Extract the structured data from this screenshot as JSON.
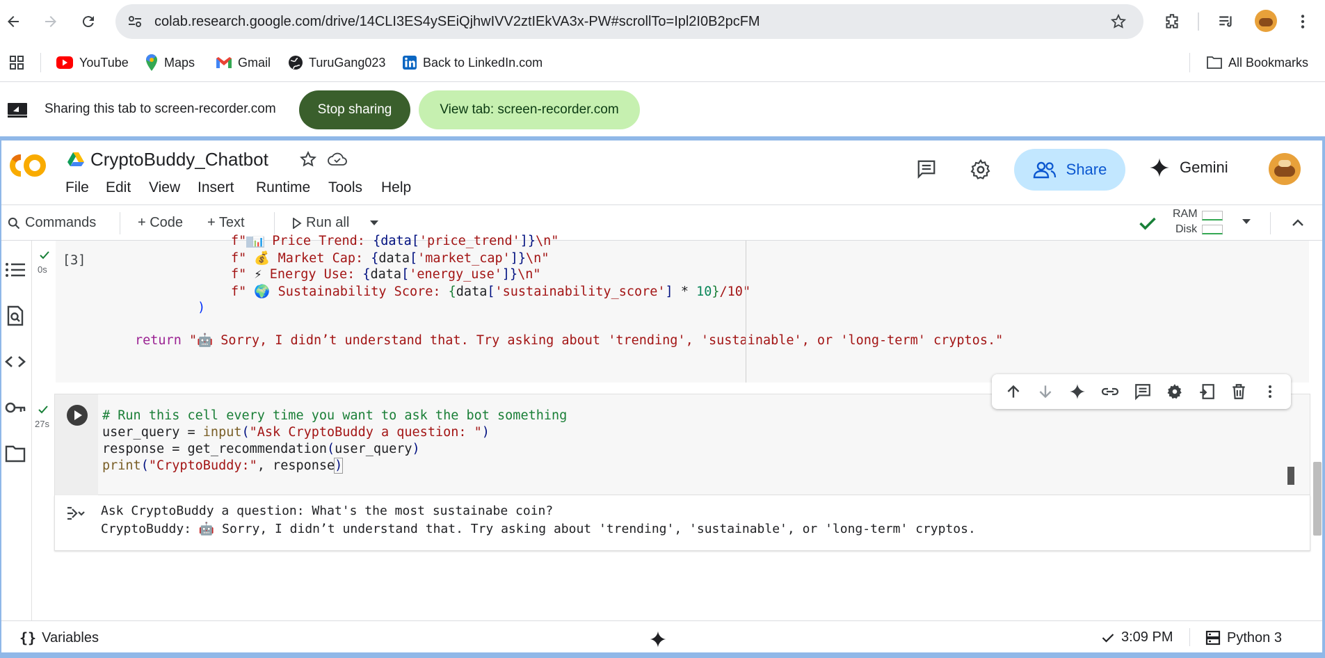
{
  "browser": {
    "url": "colab.research.google.com/drive/14CLI3ES4ySEiQjhwIVV2ztIEkVA3x-PW#scrollTo=Ipl2I0B2pcFM",
    "bookmarks": [
      {
        "label": "YouTube",
        "icon": "youtube-icon"
      },
      {
        "label": "Maps",
        "icon": "maps-icon"
      },
      {
        "label": "Gmail",
        "icon": "gmail-icon"
      },
      {
        "label": "TuruGang023",
        "icon": "globe-icon"
      },
      {
        "label": "Back to LinkedIn.com",
        "icon": "linkedin-icon"
      }
    ],
    "all_bookmarks": "All Bookmarks"
  },
  "sharing": {
    "message": "Sharing this tab to screen-recorder.com",
    "stop_label": "Stop sharing",
    "view_label": "View tab: screen-recorder.com"
  },
  "colab": {
    "title": "CryptoBuddy_Chatbot",
    "menu": [
      "File",
      "Edit",
      "View",
      "Insert",
      "Runtime",
      "Tools",
      "Help"
    ],
    "share_label": "Share",
    "gemini_label": "Gemini",
    "toolbar": {
      "commands": "Commands",
      "code": "+ Code",
      "text": "+ Text",
      "run_all": "Run all",
      "ram": "RAM",
      "disk": "Disk"
    }
  },
  "cell1": {
    "exec_count": "[3]",
    "time": "0s",
    "lines": [
      "f\"📊 Price Trend: {data['price_trend']}\\n\"",
      "f\"💰 Market Cap: {data['market_cap']}\\n\"",
      "f\"⚡ Energy Use: {data['energy_use']}\\n\"",
      "f\"🌍 Sustainability Score: {data['sustainability_score'] * 10}/10\"",
      ")",
      "return \"🤖 Sorry, I didn’t understand that. Try asking about 'trending', 'sustainable', or 'long-term' cryptos.\""
    ]
  },
  "cell2": {
    "time": "27s",
    "lines": [
      "# Run this cell every time you want to ask the bot something",
      "user_query = input(\"Ask CryptoBuddy a question: \")",
      "response = get_recommendation(user_query)",
      "print(\"CryptoBuddy:\", response)"
    ],
    "output": [
      "Ask CryptoBuddy a question: What's the most sustainabe coin?",
      "CryptoBuddy: 🤖 Sorry, I didn’t understand that. Try asking about 'trending', 'sustainable', or 'long-term' cryptos."
    ]
  },
  "status": {
    "variables": "Variables",
    "time": "3:09 PM",
    "runtime": "Python 3"
  }
}
